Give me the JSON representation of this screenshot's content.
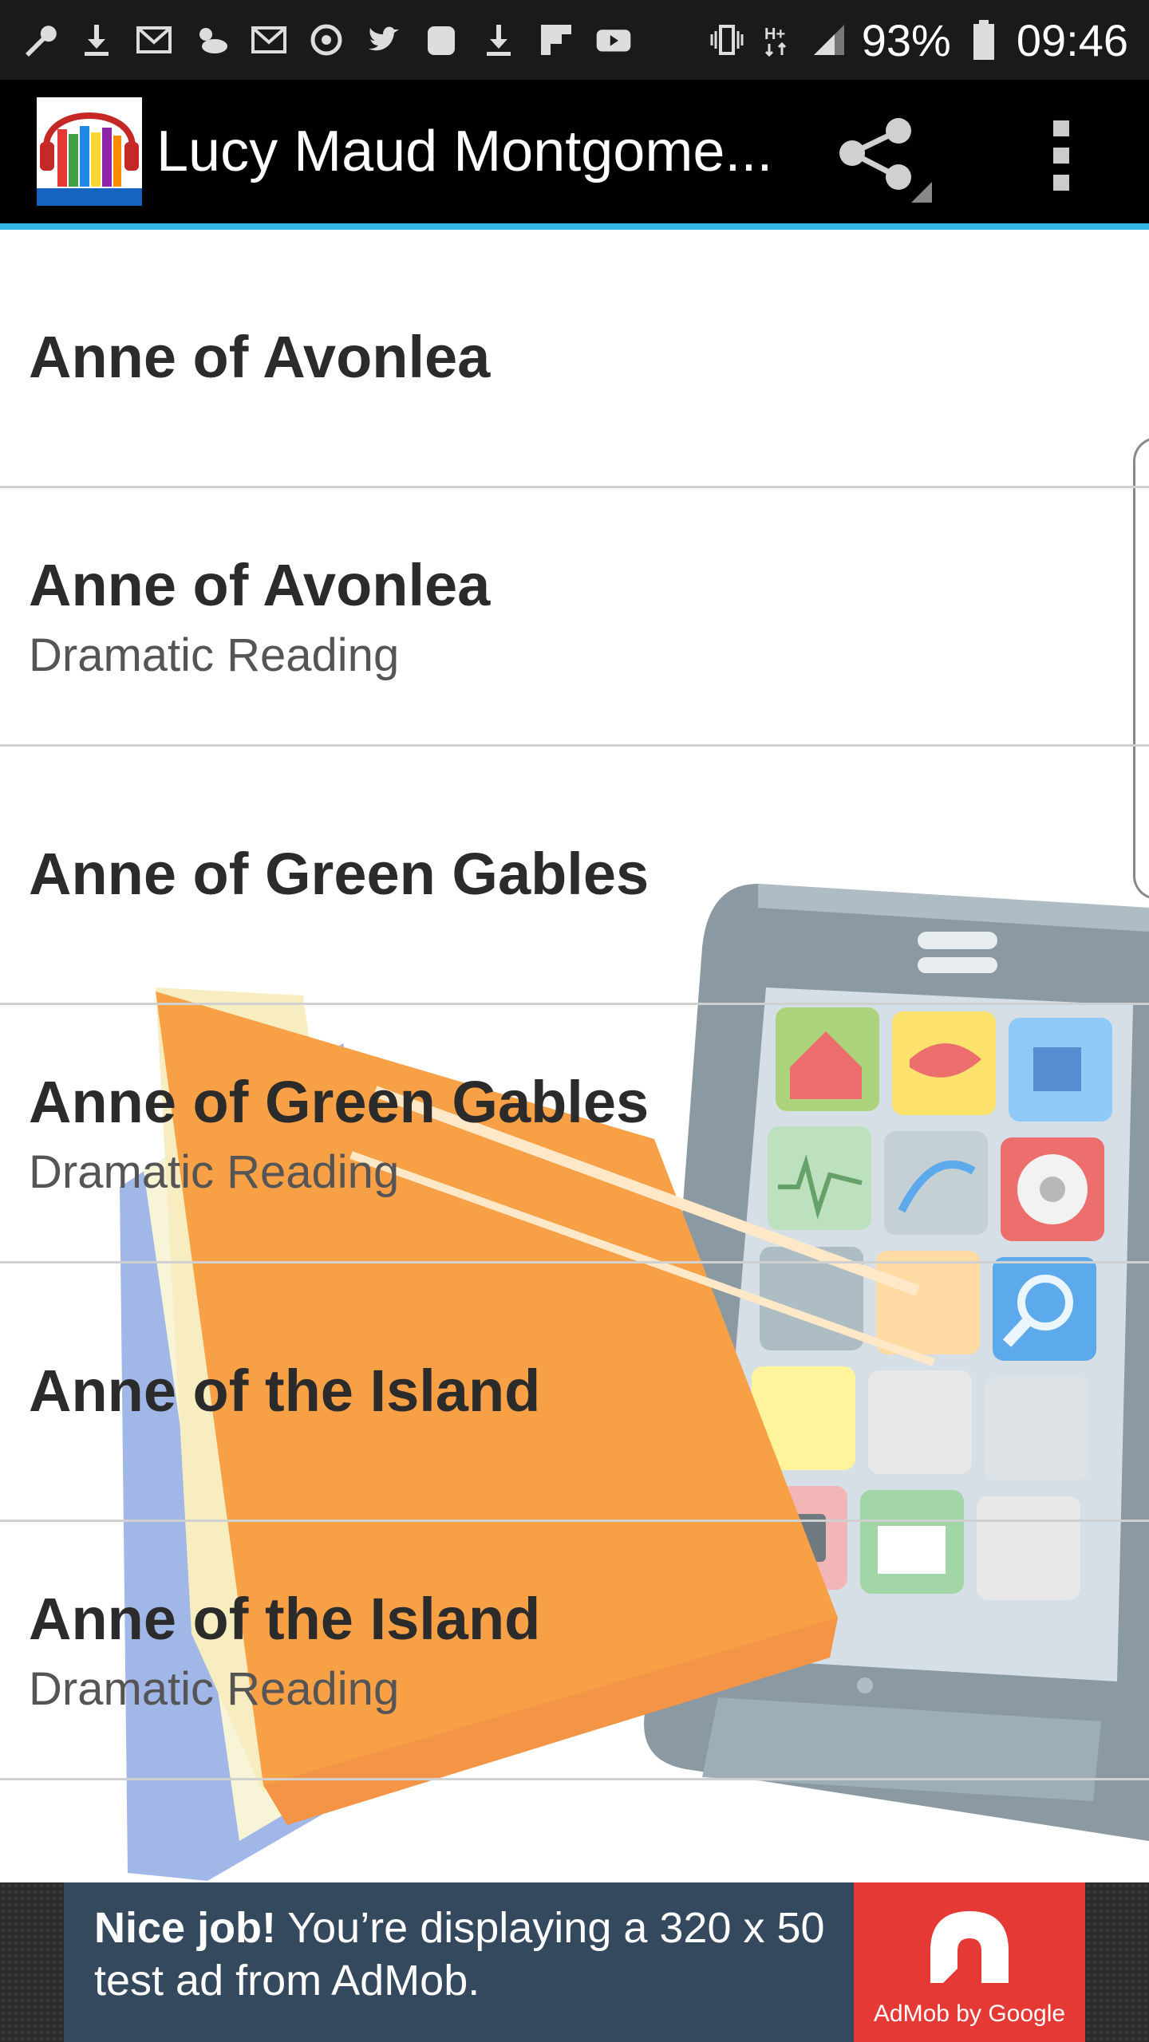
{
  "status_bar": {
    "icons": [
      "wrench-icon",
      "download-icon",
      "gmail-icon",
      "weather-icon",
      "gmail-icon",
      "sync-icon",
      "twitter-icon",
      "galaxy-icon",
      "download-icon",
      "flipboard-icon",
      "youtube-icon"
    ],
    "right_icons": [
      "vibrate-icon",
      "hplus-data-icon",
      "signal-icon"
    ],
    "battery": "93%",
    "time": "09:46"
  },
  "app_bar": {
    "title": "Lucy Maud Montgome...",
    "logo_caption": "Lucy Maud Montgomery Audiobooks",
    "accent": "#33b5e5"
  },
  "list": {
    "items": [
      {
        "title": "Anne of Avonlea",
        "subtitle": ""
      },
      {
        "title": "Anne of Avonlea",
        "subtitle": "Dramatic Reading"
      },
      {
        "title": "Anne of Green Gables",
        "subtitle": ""
      },
      {
        "title": "Anne of Green Gables",
        "subtitle": "Dramatic Reading"
      },
      {
        "title": "Anne of the Island",
        "subtitle": ""
      },
      {
        "title": "Anne of the Island",
        "subtitle": "Dramatic Reading"
      }
    ]
  },
  "ad": {
    "headline": "Nice job!",
    "body": "You’re displaying a 320 x 50 test ad from AdMob.",
    "brand": "AdMob by Google",
    "brand_color": "#e53935"
  }
}
